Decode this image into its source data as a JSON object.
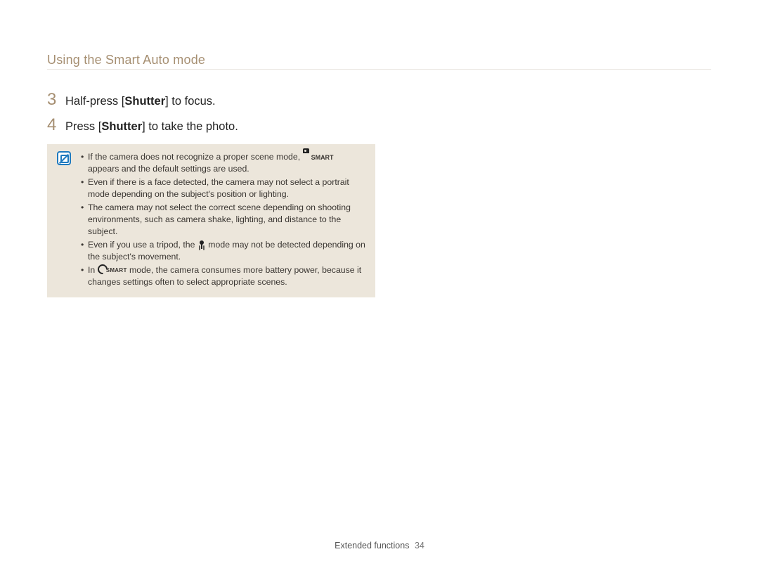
{
  "header": {
    "title": "Using the Smart Auto mode"
  },
  "steps": [
    {
      "num": "3",
      "pre": "Half-press [",
      "bold": "Shutter",
      "post": "] to focus."
    },
    {
      "num": "4",
      "pre": "Press [",
      "bold": "Shutter",
      "post": "] to take the photo."
    }
  ],
  "notes": {
    "items": [
      {
        "parts": {
          "a": "If the camera does not recognize a proper scene mode, ",
          "b": " appears and the default settings are used."
        }
      },
      {
        "text": "Even if there is a face detected, the camera may not select a portrait mode depending on the subject's position or lighting."
      },
      {
        "text": "The camera may not select the correct scene depending on shooting environments, such as camera shake, lighting, and distance to the subject."
      },
      {
        "parts": {
          "a": "Even if you use a tripod, the ",
          "b": " mode may not be detected depending on the subject's movement."
        }
      },
      {
        "parts": {
          "a": "In ",
          "b": " mode, the camera consumes more battery power, because it changes settings often to select appropriate scenes."
        }
      }
    ]
  },
  "icons": {
    "smart_label": "SMART",
    "csmart_label": "SMART"
  },
  "footer": {
    "section": "Extended functions",
    "page": "34"
  }
}
